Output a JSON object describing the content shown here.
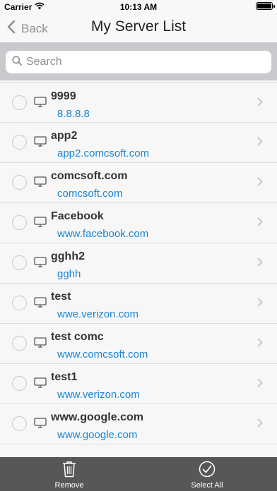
{
  "status_bar": {
    "carrier": "Carrier",
    "time": "10:13 AM",
    "wifi_icon": "wifi-icon",
    "battery_icon": "battery-icon"
  },
  "nav": {
    "back_label": "Back",
    "title": "My Server List"
  },
  "search": {
    "placeholder": "Search"
  },
  "servers": [
    {
      "name": "9999",
      "host": "8.8.8.8"
    },
    {
      "name": "app2",
      "host": "app2.comcsoft.com"
    },
    {
      "name": "comcsoft.com",
      "host": "comcsoft.com"
    },
    {
      "name": "Facebook",
      "host": "www.facebook.com"
    },
    {
      "name": "gghh2",
      "host": "gghh"
    },
    {
      "name": "test",
      "host": "wwe.verizon.com"
    },
    {
      "name": "test comc",
      "host": "www.comcsoft.com"
    },
    {
      "name": "test1",
      "host": "www.verizon.com"
    },
    {
      "name": "www.google.com",
      "host": "www.google.com"
    }
  ],
  "toolbar": {
    "remove_label": "Remove",
    "select_all_label": "Select All"
  },
  "colors": {
    "link": "#1a84d6",
    "toolbar_bg": "#575757",
    "search_bar_bg": "#c9c9ce"
  }
}
